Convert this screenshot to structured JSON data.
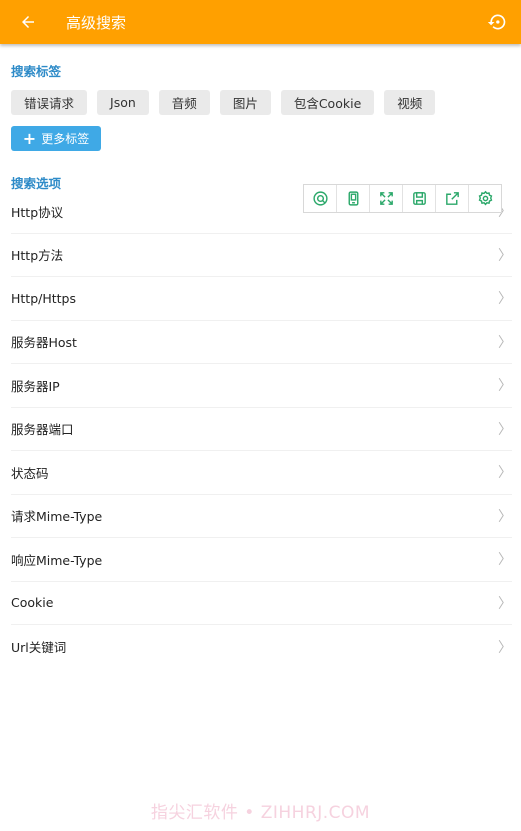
{
  "appbar": {
    "back_icon": "arrow-left-icon",
    "title": "高级搜索",
    "reset_icon": "restore-icon",
    "background": "#FFA000"
  },
  "tags_section": {
    "label": "搜索标签",
    "tags": [
      "错误请求",
      "Json",
      "音频",
      "图片",
      "包含Cookie",
      "视频"
    ],
    "more_button": "更多标签"
  },
  "options_section": {
    "label": "搜索选项",
    "items": [
      "Http协议",
      "Http方法",
      "Http/Https",
      "服务器Host",
      "服务器IP",
      "服务器端口",
      "状态码",
      "请求Mime-Type",
      "响应Mime-Type",
      "Cookie",
      "Url关键词"
    ]
  },
  "floating_toolbar": {
    "icons": [
      "search-circle-icon",
      "phone-icon",
      "fullscreen-icon",
      "save-icon",
      "share-icon",
      "settings-icon"
    ],
    "color": "#2BA86A"
  },
  "watermark": "指尖汇软件 • ZIHHRJ.COM",
  "colors": {
    "accent_label": "#2E8BC8",
    "more_button": "#3FA9E6"
  }
}
